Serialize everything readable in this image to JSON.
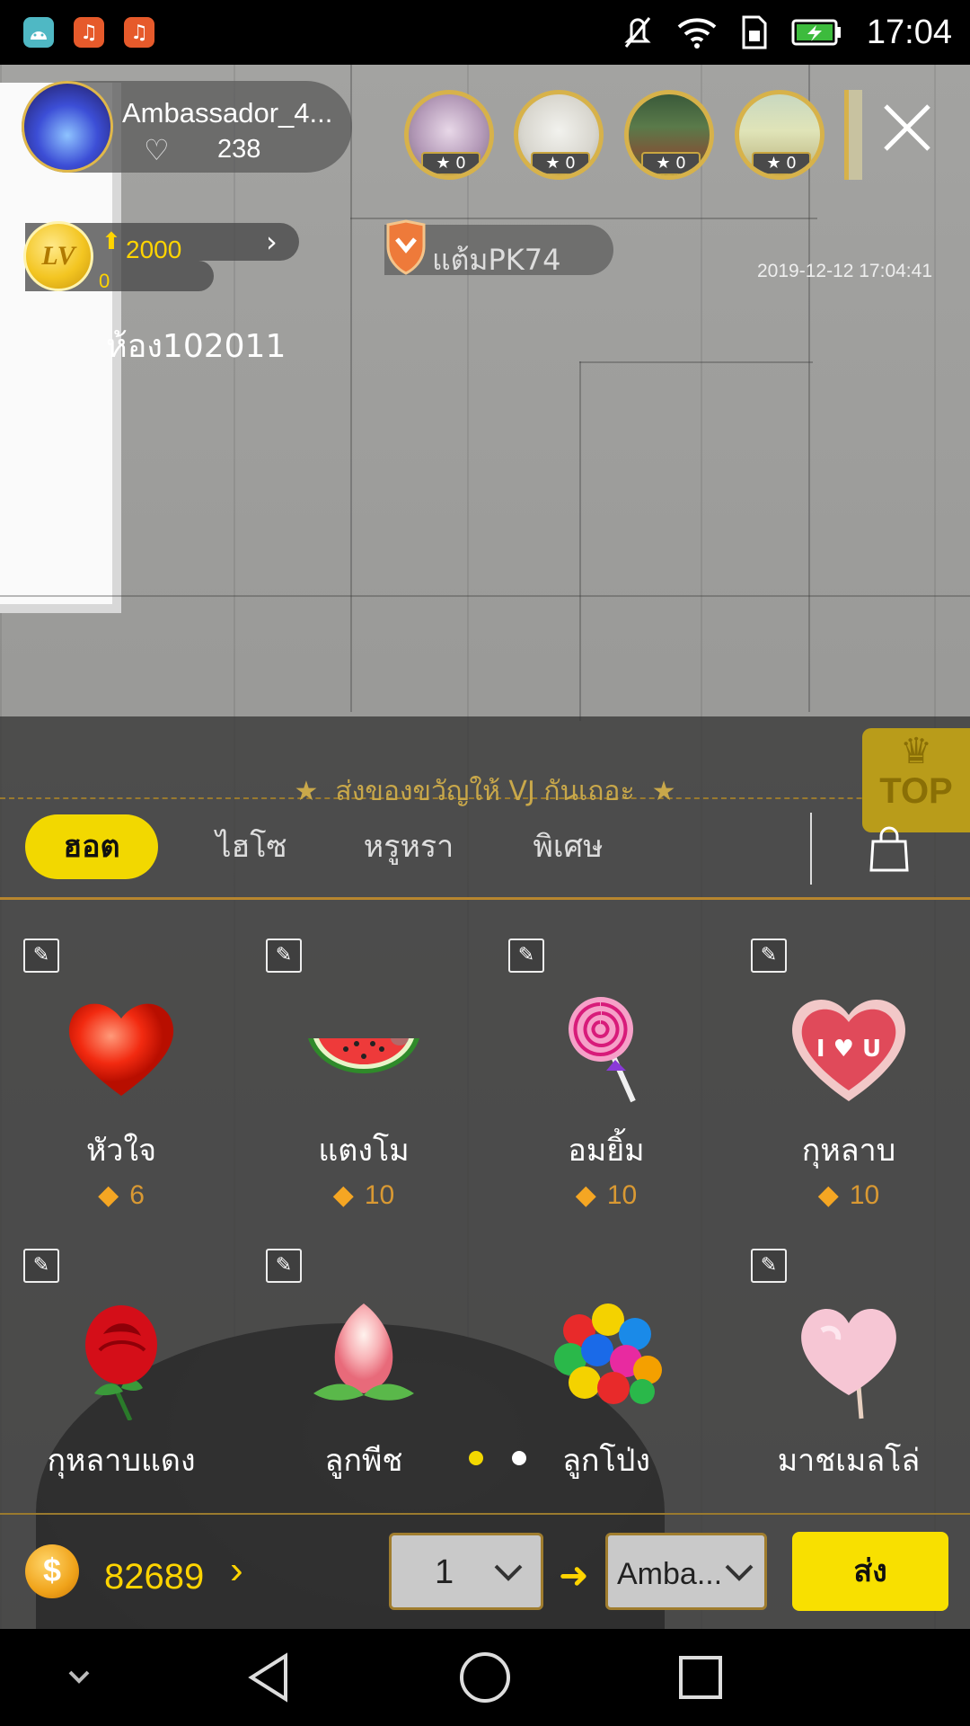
{
  "status_bar": {
    "time": "17:04",
    "icons": [
      "android-icon",
      "music-app-icon",
      "music-app-icon",
      "mute-icon",
      "wifi-icon",
      "sim-icon",
      "battery-charging-icon"
    ]
  },
  "host": {
    "name": "Ambassador_4...",
    "likes": "238"
  },
  "viewers": [
    {
      "score": "0"
    },
    {
      "score": "0"
    },
    {
      "score": "0"
    },
    {
      "score": "0"
    }
  ],
  "level": {
    "badge": "LV",
    "next_exp": "2000",
    "current": "0"
  },
  "pk": {
    "label": "แต้มPK74"
  },
  "timestamp": "2019-12-12 17:04:41",
  "room_id": "ห้อง102011",
  "gift_panel": {
    "header": "ส่งของขวัญให้ VJ กันเถอะ",
    "top_badge": "TOP",
    "tabs": [
      {
        "label": "ฮอต",
        "active": true
      },
      {
        "label": "ไฮโซ",
        "active": false
      },
      {
        "label": "หรูหรา",
        "active": false
      },
      {
        "label": "พิเศษ",
        "active": false
      }
    ],
    "gifts": [
      {
        "name": "หัวใจ",
        "price": "6",
        "icon": "heart"
      },
      {
        "name": "แตงโม",
        "price": "10",
        "icon": "watermelon"
      },
      {
        "name": "อมยิ้ม",
        "price": "10",
        "icon": "lollipop"
      },
      {
        "name": "กุหลาบ",
        "price": "10",
        "icon": "rose-heart-box"
      },
      {
        "name": "กุหลาบแดง",
        "price": "",
        "icon": "red-rose"
      },
      {
        "name": "ลูกพีช",
        "price": "",
        "icon": "peach"
      },
      {
        "name": "ลูกโป่ง",
        "price": "",
        "icon": "balloons"
      },
      {
        "name": "มาชเมลโล่",
        "price": "",
        "icon": "cotton-candy"
      }
    ],
    "page": {
      "current": 1,
      "total": 2
    }
  },
  "wallet": {
    "coins": "82689"
  },
  "send": {
    "quantity": "1",
    "target": "Amba...",
    "button_label": "ส่ง"
  },
  "colors": {
    "accent_yellow": "#f2d800",
    "gold": "#d7b24a",
    "price_orange": "#d99933"
  }
}
